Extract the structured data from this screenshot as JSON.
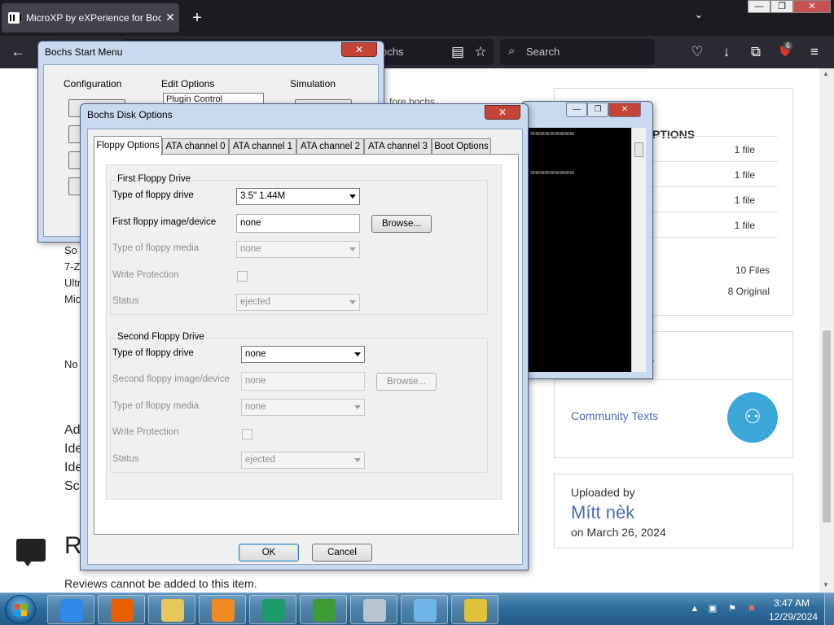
{
  "browser": {
    "tab_title": "MicroXP by eXPerience for Boch",
    "tab_close": "✕",
    "new_tab": "+",
    "list_tabs": "⌄",
    "url_fragment": "ochs",
    "search_placeholder": "Search",
    "extension_badge": "6",
    "icons": {
      "back": "←",
      "reader": "▤",
      "bookmark": "☆",
      "search": "⌕",
      "pocket": "♡",
      "download": "↓",
      "extensions": "⧉",
      "menu": "≡"
    }
  },
  "host_window_controls": {
    "minimize": "—",
    "restore": "❐",
    "close": "✕"
  },
  "page": {
    "download_header": "PTIONS",
    "download_rows": [
      {
        "count": "1 file"
      },
      {
        "count": "1 file"
      },
      {
        "count": "1 file"
      },
      {
        "count": "1 file"
      }
    ],
    "total_files": "10 Files",
    "original_files": "8 Original",
    "collections_header": "NS",
    "collection_link": "Community Texts",
    "uploaded_by_label": "Uploaded by",
    "uploader_name": "Mítt nèk",
    "upload_date": "on March 26, 2024",
    "left_fragments": [
      "So",
      "7-Z",
      "Ultr",
      "Mic",
      "No"
    ],
    "left_big_fragments": [
      "Ad",
      "Ide",
      "Ide",
      "Sc"
    ],
    "reviews_initial": "R",
    "reviews_message": "Reviews cannot be added to this item."
  },
  "start_menu": {
    "title": "Bochs Start Menu",
    "close": "✕",
    "groups": [
      "Configuration",
      "Edit Options",
      "Simulation"
    ],
    "edit_combo": "Plugin Control",
    "overflow_text": "fore bochs"
  },
  "console": {
    "lines": [
      "=========",
      "========="
    ],
    "controls": {
      "minimize": "—",
      "restore": "❐",
      "close": "✕"
    }
  },
  "disk_dialog": {
    "title": "Bochs Disk Options",
    "close": "✕",
    "tabs": [
      "Floppy Options",
      "ATA channel 0",
      "ATA channel 1",
      "ATA channel 2",
      "ATA channel 3",
      "Boot Options"
    ],
    "first_group": {
      "legend": "First Floppy Drive",
      "type_label": "Type of floppy drive",
      "type_value": "3.5\" 1.44M",
      "image_label": "First floppy image/device",
      "image_value": "none",
      "browse": "Browse...",
      "media_label": "Type of floppy media",
      "media_value": "none",
      "write_label": "Write Protection",
      "status_label": "Status",
      "status_value": "ejected"
    },
    "second_group": {
      "legend": "Second Floppy Drive",
      "type_label": "Type of floppy drive",
      "type_value": "none",
      "image_label": "Second floppy image/device",
      "image_value": "none",
      "browse": "Browse...",
      "media_label": "Type of floppy media",
      "media_value": "none",
      "write_label": "Write Protection",
      "status_label": "Status",
      "status_value": "ejected"
    },
    "ok": "OK",
    "cancel": "Cancel"
  },
  "taskbar": {
    "apps": [
      {
        "name": "internet-explorer",
        "color": "#2e8ae6"
      },
      {
        "name": "firefox",
        "color": "#e66000"
      },
      {
        "name": "file-explorer",
        "color": "#e8c65a"
      },
      {
        "name": "media-player",
        "color": "#f08a24"
      },
      {
        "name": "app-green",
        "color": "#1d9a6c"
      },
      {
        "name": "download-manager",
        "color": "#3d9b35"
      },
      {
        "name": "computer",
        "color": "#b8c4d0"
      },
      {
        "name": "app-blue",
        "color": "#6fb6e6"
      },
      {
        "name": "bochs",
        "color": "#e0c23a"
      }
    ],
    "tray": {
      "show_hidden": "▲",
      "network": "▣",
      "flag": "⚑",
      "volume": "✖"
    },
    "time": "3:47 AM",
    "date": "12/29/2024"
  }
}
